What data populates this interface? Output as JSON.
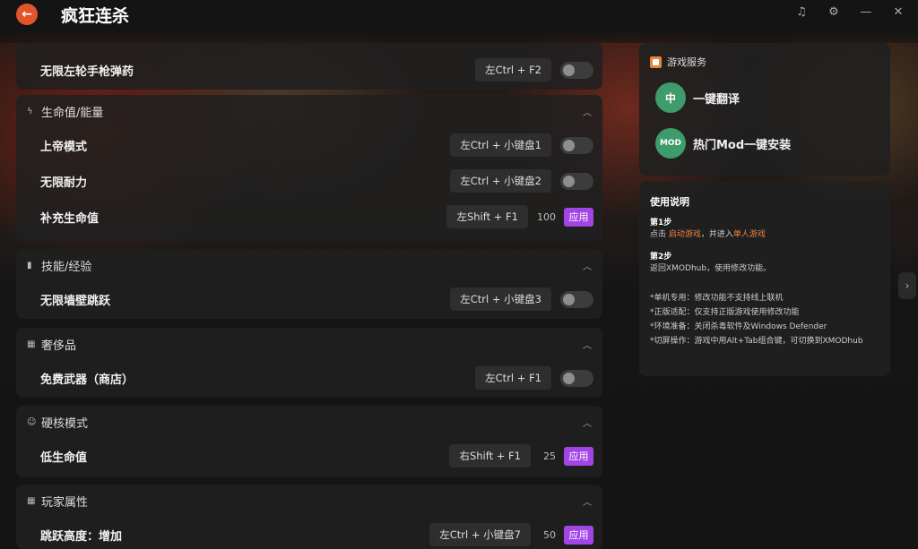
{
  "app": {
    "title": "疯狂连杀"
  },
  "window_controls": [
    "headset-icon",
    "settings-icon",
    "minimize-icon",
    "close-icon"
  ],
  "sections": [
    {
      "id": "top",
      "rows": [
        {
          "label": "无限左轮手枪弹药",
          "hotkey": "左Ctrl + F2",
          "control": "toggle"
        }
      ]
    },
    {
      "id": "health",
      "header": "生命值/能量",
      "rows": [
        {
          "label": "上帝模式",
          "hotkey": "左Ctrl + 小键盘1",
          "control": "toggle"
        },
        {
          "label": "无限耐力",
          "hotkey": "左Ctrl + 小键盘2",
          "control": "toggle"
        },
        {
          "label": "补充生命值",
          "hotkey": "左Shift + F1",
          "value": "100",
          "apply": "应用"
        }
      ]
    },
    {
      "id": "skills",
      "header": "技能/经验",
      "rows": [
        {
          "label": "无限墙壁跳跃",
          "hotkey": "左Ctrl + 小键盘3",
          "control": "toggle"
        }
      ]
    },
    {
      "id": "luxury",
      "header": "奢侈品",
      "rows": [
        {
          "label": "免费武器（商店）",
          "hotkey": "左Ctrl + F1",
          "control": "toggle"
        }
      ]
    },
    {
      "id": "hardcore",
      "header": "硬核模式",
      "rows": [
        {
          "label": "低生命值",
          "hotkey": "右Shift + F1",
          "value": "25",
          "apply": "应用"
        }
      ]
    },
    {
      "id": "player",
      "header": "玩家属性",
      "rows": [
        {
          "label": "跳跃高度：增加",
          "hotkey": "左Ctrl + 小键盘7",
          "value": "50",
          "apply": "应用"
        }
      ]
    }
  ],
  "services": {
    "title": "游戏服务",
    "items": [
      {
        "label": "一键翻译",
        "icon_text": "中"
      },
      {
        "label": "热门Mod一键安装",
        "icon_text": "MOD"
      }
    ]
  },
  "instructions": {
    "title": "使用说明",
    "step1_title": "第1步",
    "step1_pre": "点击 ",
    "step1_link1": "启动游戏",
    "step1_mid": "，并进入",
    "step1_link2": "单人游戏",
    "step2_title": "第2步",
    "step2_text": "返回XMODhub，使用修改功能。",
    "notes": [
      "*单机专用：修改功能不支持线上联机",
      "*正版适配：仅支持正版游戏使用修改功能",
      "*环境准备：关闭杀毒软件及Windows Defender",
      "*切屏操作：游戏中用Alt+Tab组合键，可切换到XMODhub"
    ]
  },
  "colors": {
    "accent": "#a245e6",
    "orange": "#e0552a",
    "service_green": "#3e9b6b"
  }
}
